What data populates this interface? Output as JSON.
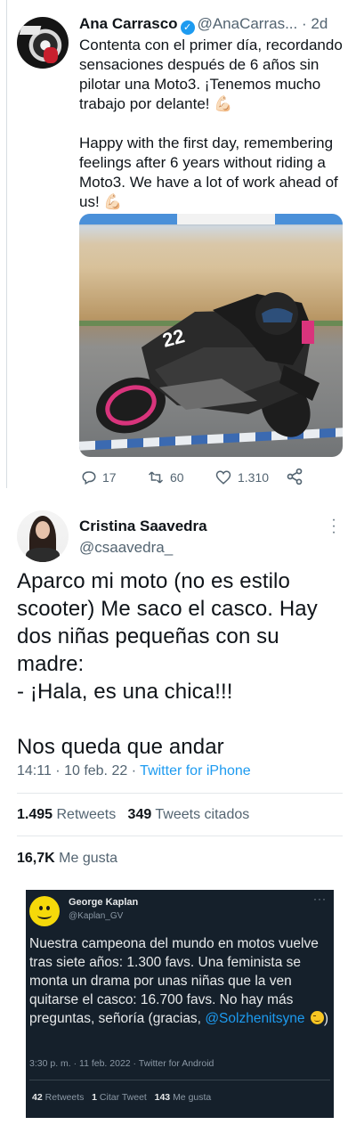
{
  "tweet1": {
    "name": "Ana Carrasco",
    "handle": "@AnaCarras...",
    "dot": "·",
    "time": "2d",
    "text_es": "Contenta con el primer día, recordando sensaciones después de 6 años sin pilotar una Moto3. ¡Tenemos mucho trabajo por delante! 💪🏻",
    "text_en": "Happy with the first day, remembering feelings after 6 years without riding a Moto3. We have a lot of work ahead of us! 💪🏻",
    "bike_number": "22",
    "replies": "17",
    "retweets": "60",
    "likes": "1.310",
    "icons": [
      "verified-badge-icon",
      "reply-icon",
      "retweet-icon",
      "like-icon",
      "share-icon"
    ]
  },
  "tweet2": {
    "name": "Cristina Saavedra",
    "handle": "@csaavedra_",
    "text": "Aparco mi moto (no es estilo scooter) Me saco el casco. Hay dos niñas pequeñas con su madre:\n- ¡Hala, es una chica!!!\n\nNos queda que andar",
    "time": "14:11 · 10 feb. 22 · ",
    "client": "Twitter for iPhone",
    "retweets_count": "1.495",
    "retweets_label": "Retweets",
    "quotes_count": "349",
    "quotes_label": "Tweets citados",
    "likes_count": "16,7K",
    "likes_label": "Me gusta"
  },
  "tweet3": {
    "name": "George Kaplan",
    "handle": "@Kaplan_GV",
    "more": "···",
    "text": "Nuestra campeona del mundo en motos vuelve tras siete años: 1.300 favs. Una feminista se monta un drama por unas niñas que la ven quitarse el casco: 16.700 favs. No hay más preguntas, señoría (gracias, ",
    "mention": "@Solzhenitsyne",
    "text_end": ")",
    "meta": "3:30 p. m. · 11 feb. 2022 · Twitter for Android",
    "retweets_count": "42",
    "retweets_label": "Retweets",
    "quotes_count": "1",
    "quotes_label": "Citar Tweet",
    "likes_count": "143",
    "likes_label": "Me gusta"
  },
  "colors": {
    "accent": "#1d9bf0",
    "text": "#0f1419",
    "muted": "#536471",
    "dark_bg": "#15202b"
  }
}
